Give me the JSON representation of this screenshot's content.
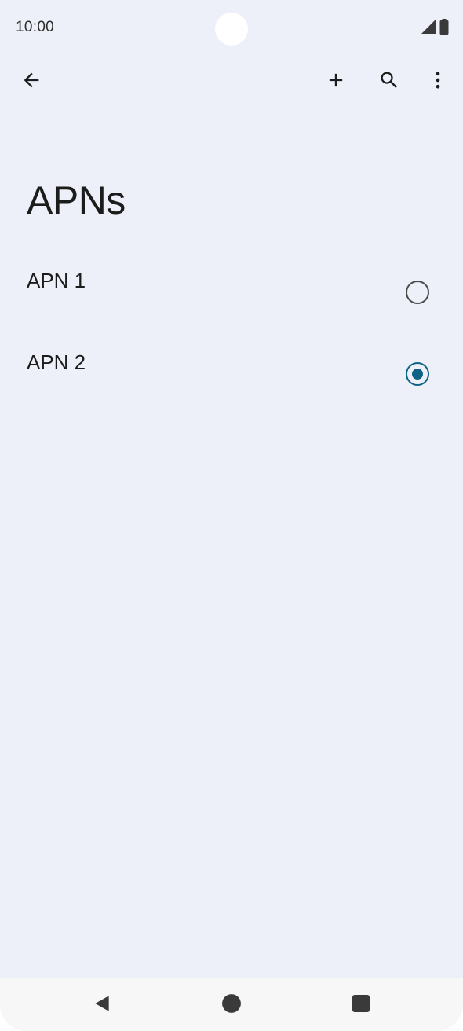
{
  "status_bar": {
    "time": "10:00",
    "icons": [
      "signal-icon",
      "battery-icon"
    ]
  },
  "app_bar": {
    "back_icon": "arrow-back-icon",
    "actions": [
      "add-icon",
      "search-icon",
      "more-vert-icon"
    ]
  },
  "page": {
    "title": "APNs"
  },
  "apns": [
    {
      "label": "APN 1",
      "selected": false
    },
    {
      "label": "APN 2",
      "selected": true
    }
  ],
  "nav_bar": {
    "buttons": [
      "nav-back-icon",
      "nav-home-icon",
      "nav-recents-icon"
    ]
  },
  "colors": {
    "background": "#edf0f8",
    "accent": "#0e6384",
    "text": "#1c1c1c"
  }
}
